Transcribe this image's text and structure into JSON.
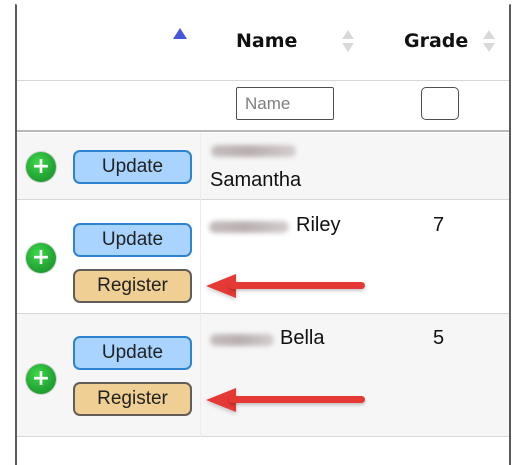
{
  "header": {
    "name_label": "Name",
    "grade_label": "Grade"
  },
  "filters": {
    "name_placeholder": "Name",
    "name_value": "",
    "grade_checked": false
  },
  "rows": [
    {
      "name_prefix_visible": "",
      "name_suffix": "Samantha",
      "grade": "",
      "buttons": {
        "update_label": "Update",
        "register_label": ""
      }
    },
    {
      "name_prefix_visible": "",
      "name_suffix": "Riley",
      "grade": "7",
      "buttons": {
        "update_label": "Update",
        "register_label": "Register"
      }
    },
    {
      "name_prefix_visible": "",
      "name_suffix": "Bella",
      "grade": "5",
      "buttons": {
        "update_label": "Update",
        "register_label": "Register"
      }
    }
  ],
  "icons": {
    "add": "plus-circle-icon",
    "sort_up": "sort-up-icon",
    "sort_both": "sort-both-icon",
    "arrow": "arrow-left-icon"
  },
  "colors": {
    "sort_active": "#4557d6",
    "update_bg": "#a8d4ff",
    "register_bg": "#efcf94",
    "add_icon": "#24a635",
    "arrow": "#e53935"
  }
}
